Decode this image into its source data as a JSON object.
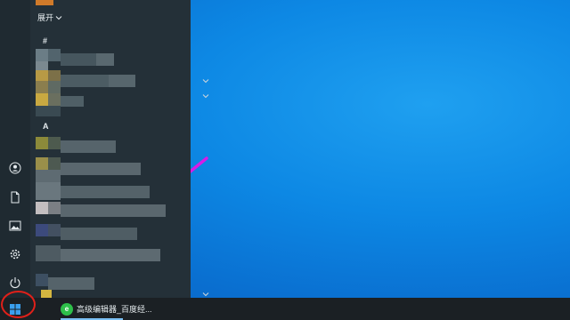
{
  "colors": {
    "desktop": "#0d88e4",
    "start_menu": "#243038",
    "taskbar": "#1b2024",
    "annotation_arrow": "#d81be6",
    "annotation_circle": "#e0201a"
  },
  "start_menu": {
    "expand_label": "展开",
    "expand_icon": "chevron-down-icon",
    "group_headers": [
      "#",
      "A"
    ],
    "rail_icons": [
      "user-icon",
      "document-icon",
      "pictures-icon",
      "settings-icon",
      "power-icon"
    ]
  },
  "taskbar": {
    "start_icon": "windows-logo-icon",
    "apps": [
      {
        "label": "高级编辑器_百度经...",
        "icon": "browser-icon"
      }
    ]
  },
  "annotation": {
    "type": "arrow",
    "target": "start-button",
    "highlight": "circle"
  }
}
